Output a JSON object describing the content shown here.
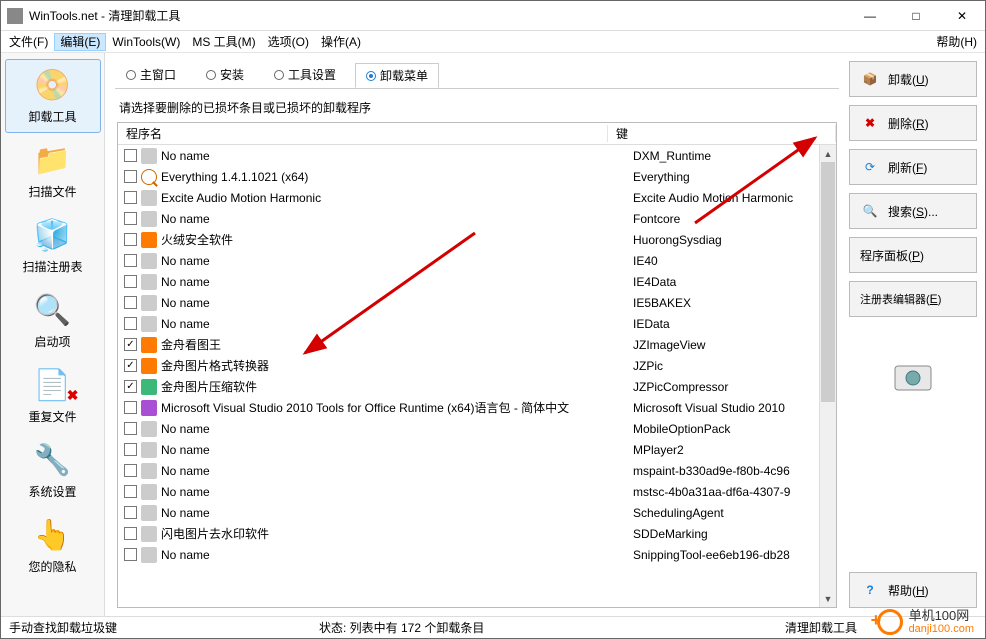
{
  "title": "WinTools.net - 清理卸载工具",
  "menu": {
    "items": [
      "文件(F)",
      "编辑(E)",
      "WinTools(W)",
      "MS 工具(M)",
      "选项(O)",
      "操作(A)"
    ],
    "help": "帮助(H)",
    "active_index": 1
  },
  "left_nav": {
    "items": [
      {
        "label": "卸载工具",
        "selected": true
      },
      {
        "label": "扫描文件",
        "selected": false
      },
      {
        "label": "扫描注册表",
        "selected": false
      },
      {
        "label": "启动项",
        "selected": false
      },
      {
        "label": "重复文件",
        "selected": false
      },
      {
        "label": "系统设置",
        "selected": false
      },
      {
        "label": "您的隐私",
        "selected": false
      }
    ]
  },
  "tabs": {
    "items": [
      "主窗口",
      "安装",
      "工具设置",
      "卸载菜单"
    ],
    "active_index": 3
  },
  "instruction": "请选择要删除的已损坏条目或已损坏的卸载程序",
  "columns": {
    "name": "程序名",
    "key": "键"
  },
  "rows": [
    {
      "checked": false,
      "icon": "default",
      "name": "No name",
      "key": "DXM_Runtime"
    },
    {
      "checked": false,
      "icon": "mag",
      "name": "Everything 1.4.1.1021 (x64)",
      "key": "Everything"
    },
    {
      "checked": false,
      "icon": "default",
      "name": "Excite Audio Motion Harmonic",
      "key": "Excite Audio Motion Harmonic"
    },
    {
      "checked": false,
      "icon": "default",
      "name": "No name",
      "key": "Fontcore"
    },
    {
      "checked": false,
      "icon": "orange",
      "name": "火绒安全软件",
      "key": "HuorongSysdiag"
    },
    {
      "checked": false,
      "icon": "default",
      "name": "No name",
      "key": "IE40"
    },
    {
      "checked": false,
      "icon": "default",
      "name": "No name",
      "key": "IE4Data"
    },
    {
      "checked": false,
      "icon": "default",
      "name": "No name",
      "key": "IE5BAKEX"
    },
    {
      "checked": false,
      "icon": "default",
      "name": "No name",
      "key": "IEData"
    },
    {
      "checked": true,
      "icon": "orange",
      "name": "金舟看图王",
      "key": "JZImageView"
    },
    {
      "checked": true,
      "icon": "orange",
      "name": "金舟图片格式转换器",
      "key": "JZPic"
    },
    {
      "checked": true,
      "icon": "green",
      "name": "金舟图片压缩软件",
      "key": "JZPicCompressor"
    },
    {
      "checked": false,
      "icon": "vs",
      "name": "Microsoft Visual Studio 2010 Tools for Office Runtime (x64)语言包 - 简体中文",
      "key": "Microsoft Visual Studio 2010"
    },
    {
      "checked": false,
      "icon": "default",
      "name": "No name",
      "key": "MobileOptionPack"
    },
    {
      "checked": false,
      "icon": "default",
      "name": "No name",
      "key": "MPlayer2"
    },
    {
      "checked": false,
      "icon": "default",
      "name": "No name",
      "key": "mspaint-b330ad9e-f80b-4c96"
    },
    {
      "checked": false,
      "icon": "default",
      "name": "No name",
      "key": "mstsc-4b0a31aa-df6a-4307-9"
    },
    {
      "checked": false,
      "icon": "default",
      "name": "No name",
      "key": "SchedulingAgent"
    },
    {
      "checked": false,
      "icon": "default",
      "name": "闪电图片去水印软件",
      "key": "SDDeMarking"
    },
    {
      "checked": false,
      "icon": "default",
      "name": "No name",
      "key": "SnippingTool-ee6eb196-db28"
    }
  ],
  "right_buttons": {
    "uninstall": "卸载(U)",
    "delete": "删除(R)",
    "refresh": "刷新(F)",
    "search": "搜索(S)...",
    "panel": "程序面板(P)",
    "regedit": "注册表编辑器(E)",
    "help": "帮助(H)"
  },
  "statusbar": {
    "left": "手动查找卸载垃圾键",
    "mid": "状态: 列表中有 172 个卸载条目",
    "right": "清理卸载工具"
  },
  "watermark": {
    "line1": "单机100网",
    "line2": "danji100.com"
  }
}
